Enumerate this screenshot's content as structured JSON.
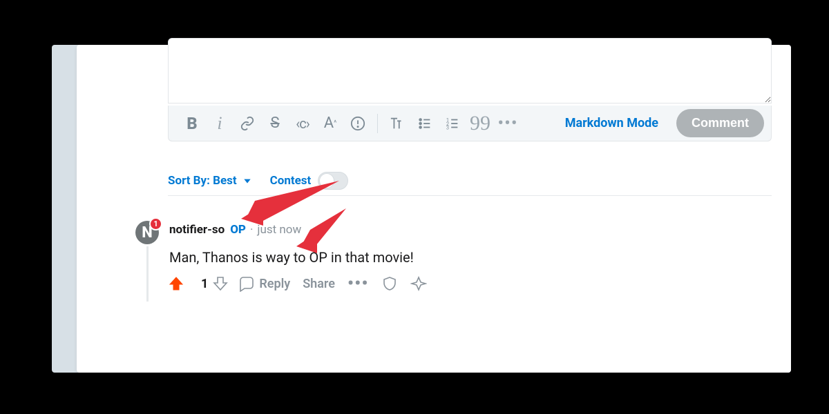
{
  "toolbar": {
    "bold": "B",
    "italic": "i",
    "strike": "S",
    "code": "‹c›",
    "heading": "A",
    "markdown_link": "Markdown Mode",
    "comment_button": "Comment"
  },
  "sort": {
    "label": "Sort By: Best",
    "contest_label": "Contest",
    "contest_on": false
  },
  "comment": {
    "avatar_letter": "N",
    "avatar_badge": "1",
    "author": "notifier-so",
    "op_badge": "OP",
    "separator": "·",
    "timestamp": "just now",
    "body": "Man, Thanos is way to OP in that movie!",
    "score": "1",
    "reply_label": "Reply",
    "share_label": "Share"
  }
}
